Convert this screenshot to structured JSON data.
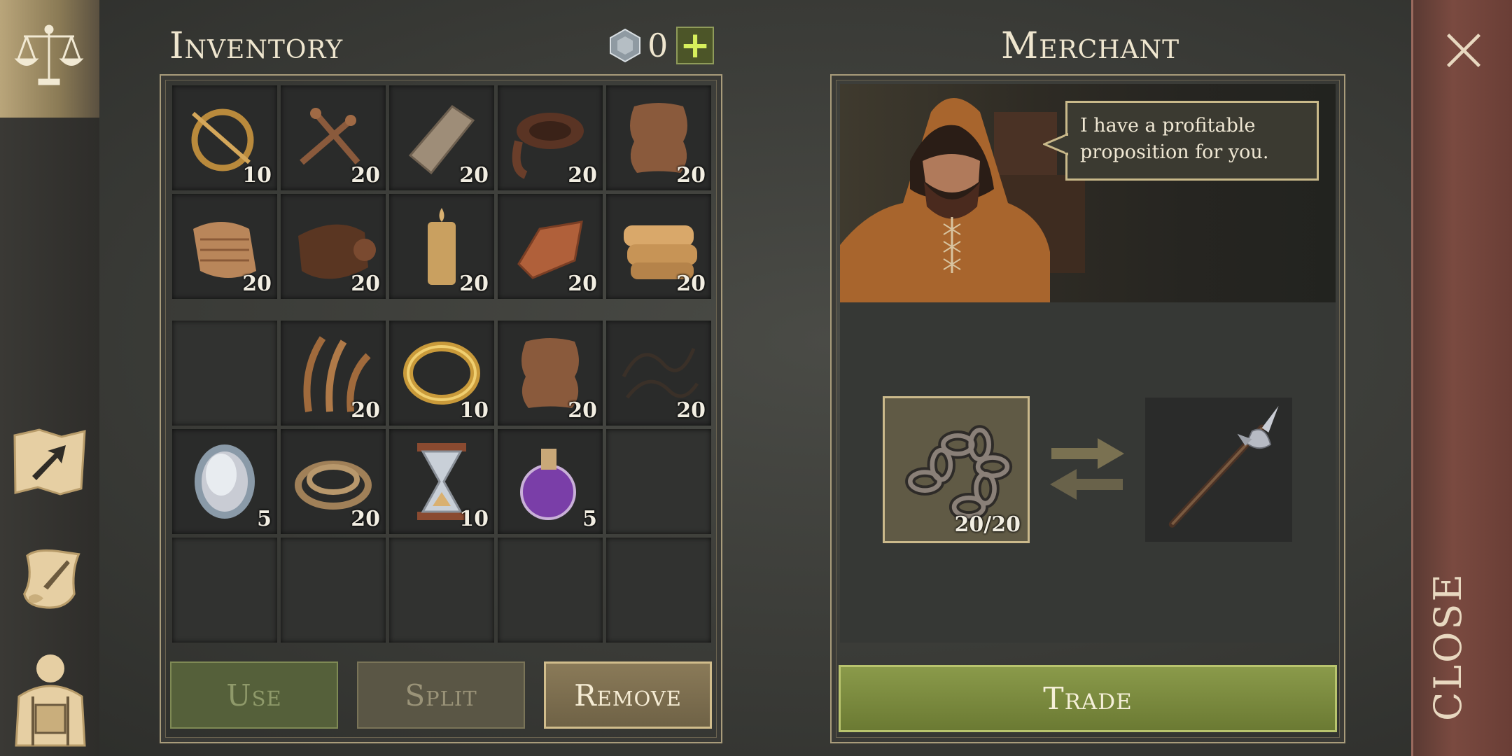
{
  "inventory": {
    "title": "Inventory",
    "currency_amount": "0",
    "currency_add_label": "+",
    "items_top": [
      {
        "icon": "brooch-icon",
        "count": "10"
      },
      {
        "icon": "nails-icon",
        "count": "20"
      },
      {
        "icon": "plank-icon",
        "count": "20"
      },
      {
        "icon": "leather-strips-icon",
        "count": "20"
      },
      {
        "icon": "hide-icon",
        "count": "20"
      },
      {
        "icon": "cloth-scrap-icon",
        "count": "20"
      },
      {
        "icon": "leather-roll-icon",
        "count": "20"
      },
      {
        "icon": "candle-icon",
        "count": "20"
      },
      {
        "icon": "copper-ingot-icon",
        "count": "20"
      },
      {
        "icon": "folded-cloth-icon",
        "count": "20"
      }
    ],
    "items_bottom": [
      {
        "icon": "",
        "count": ""
      },
      {
        "icon": "fibers-icon",
        "count": "20"
      },
      {
        "icon": "gold-ring-icon",
        "count": "10"
      },
      {
        "icon": "hide-icon",
        "count": "20"
      },
      {
        "icon": "wire-icon",
        "count": "20"
      },
      {
        "icon": "mirror-icon",
        "count": "5"
      },
      {
        "icon": "rope-icon",
        "count": "20"
      },
      {
        "icon": "hourglass-icon",
        "count": "10"
      },
      {
        "icon": "potion-icon",
        "count": "5"
      },
      {
        "icon": "",
        "count": ""
      },
      {
        "icon": "",
        "count": ""
      },
      {
        "icon": "",
        "count": ""
      },
      {
        "icon": "",
        "count": ""
      },
      {
        "icon": "",
        "count": ""
      },
      {
        "icon": "",
        "count": ""
      }
    ],
    "buttons": {
      "use": "Use",
      "split": "Split",
      "remove": "Remove"
    }
  },
  "merchant": {
    "title": "Merchant",
    "speech": "I have a profitable proposition for you.",
    "offer_count": "20/20",
    "offer_icon": "chain-icon",
    "receive_icon": "halberd-icon",
    "trade_label": "Trade"
  },
  "close_label": "CLOSE",
  "colors": {
    "accent_gold": "#c8b98a",
    "trade_green": "#8a9a4c",
    "panel_dark": "#2a2b2a"
  }
}
